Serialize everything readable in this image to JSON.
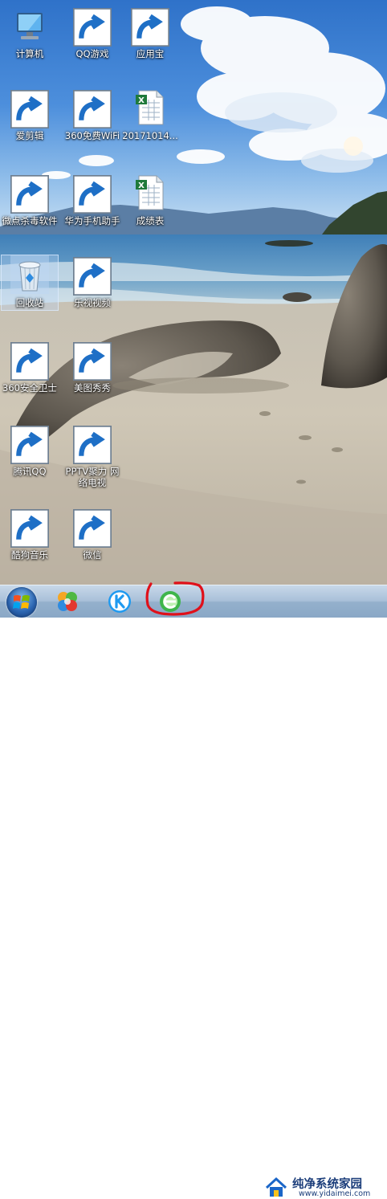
{
  "desktop": {
    "icons": [
      {
        "label": "计算机"
      },
      {
        "label": "QQ游戏"
      },
      {
        "label": "应用宝"
      },
      {
        "label": "爱剪辑"
      },
      {
        "label": "360免费WiFi"
      },
      {
        "label": "20171014..."
      },
      {
        "label": "微点杀毒软件"
      },
      {
        "label": "华为手机助手"
      },
      {
        "label": "成绩表"
      },
      {
        "label": "回收站"
      },
      {
        "label": "乐视视频"
      },
      {
        "label": "360安全卫士"
      },
      {
        "label": "美图秀秀"
      },
      {
        "label": "腾讯QQ"
      },
      {
        "label": "PPTV聚力 网络电视"
      },
      {
        "label": "酷狗音乐"
      },
      {
        "label": "微信"
      }
    ]
  },
  "taskbar": {
    "pinned": [
      {
        "icon": "start-orb-icon"
      },
      {
        "icon": "colorful-app-icon"
      },
      {
        "icon": "kugou-k-icon"
      },
      {
        "icon": "browser-e-icon"
      }
    ]
  },
  "watermark": {
    "name": "纯净系统家园",
    "url": "www.yidaimei.com"
  },
  "colors": {
    "annotation": "#e0101a",
    "taskbar": "#a9c0d9"
  }
}
